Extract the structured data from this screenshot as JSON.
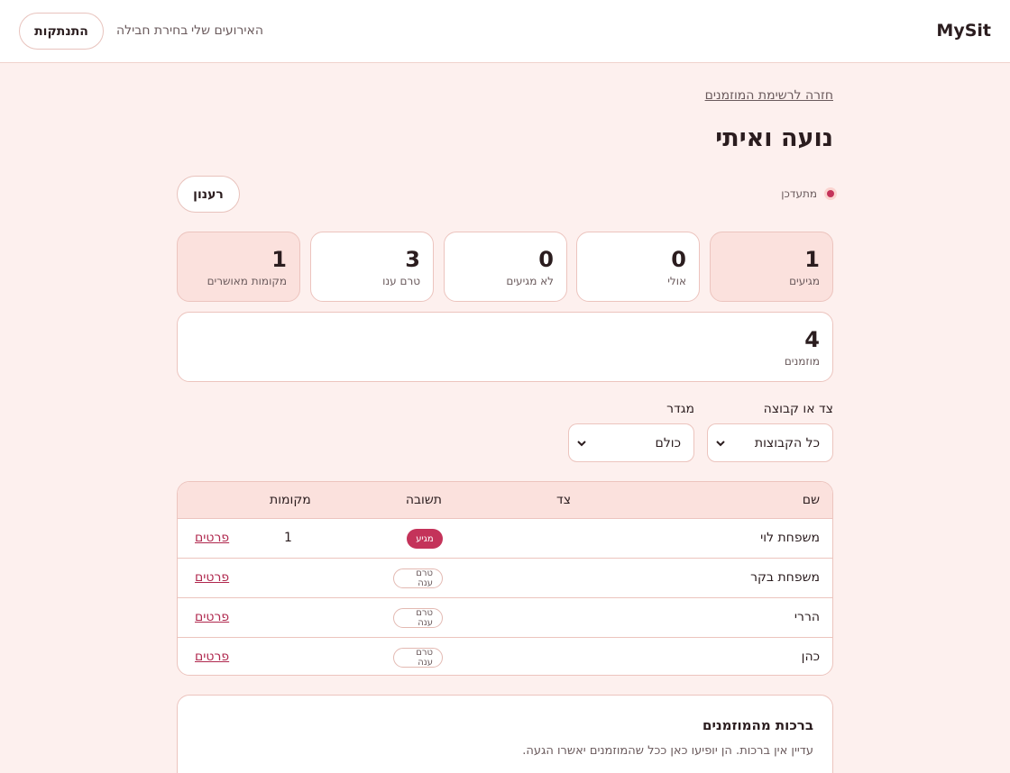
{
  "app": {
    "brand": "MySit"
  },
  "nav": {
    "my_events": "האירועים שלי",
    "choose_package": "בחירת חבילה",
    "logout": "התנתקות"
  },
  "page": {
    "back_link": "חזרה לרשימת המוזמנים",
    "event_title": "נועה ואיתי",
    "live_status": "מתעדכן",
    "refresh": "רענון"
  },
  "stats": {
    "coming": {
      "value": "1",
      "label": "מגיעים"
    },
    "maybe": {
      "value": "0",
      "label": "אולי"
    },
    "not_coming": {
      "value": "0",
      "label": "לא מגיעים"
    },
    "pending": {
      "value": "3",
      "label": "טרם ענו"
    },
    "confirmed_seats": {
      "value": "1",
      "label": "מקומות מאושרים"
    },
    "invited": {
      "value": "4",
      "label": "מוזמנים"
    }
  },
  "filters": {
    "group": {
      "label": "צד או קבוצה",
      "value": "כל הקבוצות"
    },
    "gender": {
      "label": "מגדר",
      "value": "כולם"
    }
  },
  "table": {
    "headers": {
      "name": "שם",
      "side": "צד",
      "response": "תשובה",
      "seats": "מקומות"
    },
    "details_label": "פרטים",
    "rows": [
      {
        "name": "משפחת לוי",
        "side": "",
        "response": "מגיע",
        "seats": "1"
      },
      {
        "name": "משפחת בקר",
        "side": "",
        "response": "טרם ענה",
        "seats": ""
      },
      {
        "name": "הררי",
        "side": "",
        "response": "טרם ענה",
        "seats": ""
      },
      {
        "name": "כהן",
        "side": "",
        "response": "טרם ענה",
        "seats": ""
      }
    ]
  },
  "blessings": {
    "title": "ברכות מהמוזמנים",
    "empty": "עדיין אין ברכות. הן יופיעו כאן ככל שהמוזמנים יאשרו הגעה."
  },
  "colors": {
    "accent": "#c4335a",
    "page_bg": "#fdf0ee",
    "card_tint": "#fbe1dd",
    "border": "#ecc4be"
  },
  "icons": {
    "select_chevron": "chevron-down-icon",
    "live_indicator": "live-dot-icon"
  }
}
